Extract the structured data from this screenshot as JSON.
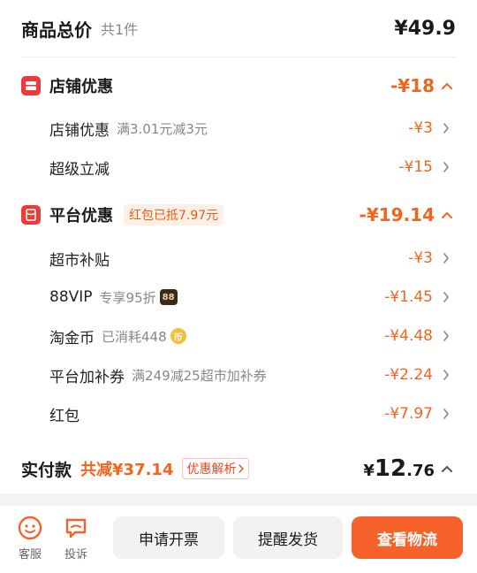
{
  "total": {
    "title": "商品总价",
    "count": "共1件",
    "amount": "¥49.9"
  },
  "shop_discount": {
    "title": "店铺优惠",
    "amount": "-¥18",
    "items": [
      {
        "label": "店铺优惠",
        "note": "满3.01元减3元",
        "amount": "-¥3"
      },
      {
        "label": "超级立减",
        "note": "",
        "amount": "-¥15"
      }
    ]
  },
  "platform_discount": {
    "title": "平台优惠",
    "tag": "红包已抵7.97元",
    "amount": "-¥19.14",
    "items": [
      {
        "label": "超市补贴",
        "note": "",
        "amount": "-¥3"
      },
      {
        "label": "88VIP",
        "note": "专享95折",
        "badge": "88",
        "amount": "-¥1.45"
      },
      {
        "label": "淘金币",
        "note": "已消耗448",
        "badge": "币",
        "amount": "-¥4.48"
      },
      {
        "label": "平台加补券",
        "note": "满249减25超市加补券",
        "amount": "-¥2.24"
      },
      {
        "label": "红包",
        "note": "",
        "amount": "-¥7.97"
      }
    ]
  },
  "payment": {
    "label": "实付款",
    "saved": "共减¥37.14",
    "detail": "优惠解析",
    "currency": "¥",
    "integer": "12",
    "decimal": ".76"
  },
  "bottom": {
    "service_label": "客服",
    "complaint_label": "投诉",
    "invoice_label": "申请开票",
    "remind_label": "提醒发货",
    "logistics_label": "查看物流"
  },
  "colors": {
    "accent": "#f0661e",
    "button_orange": "#f5632a",
    "badge_red": "#ef3a3a"
  }
}
